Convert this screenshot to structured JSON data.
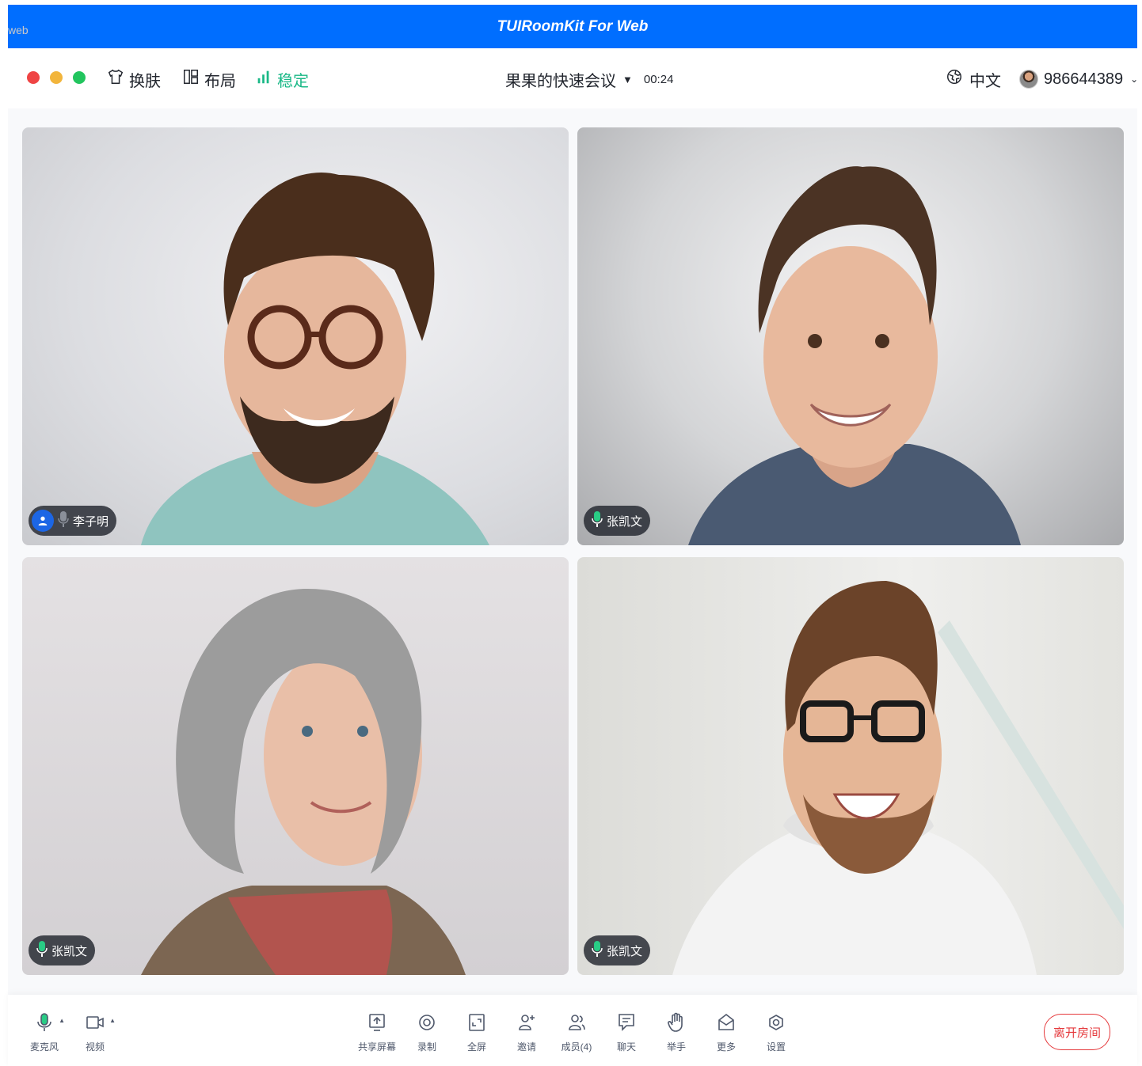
{
  "watermark": "web",
  "app": {
    "title": "TUIRoomKit For Web"
  },
  "header": {
    "window_dots": {
      "close": "#ef4444",
      "minimize": "#f2b53c",
      "maximize": "#22c55e"
    },
    "skin_label": "换肤",
    "layout_label": "布局",
    "network_label": "稳定",
    "room_name": "果果的快速会议",
    "timer": "00:24",
    "language": "中文",
    "user_id": "986644389"
  },
  "tiles": [
    {
      "name": "李子明",
      "is_self": true,
      "mic": "muted"
    },
    {
      "name": "张凯文",
      "is_self": false,
      "mic": "on"
    },
    {
      "name": "张凯文",
      "is_self": false,
      "mic": "on"
    },
    {
      "name": "张凯文",
      "is_self": false,
      "mic": "on"
    }
  ],
  "footer": {
    "mic_label": "麦克风",
    "camera_label": "视频",
    "share_label": "共享屏幕",
    "record_label": "录制",
    "fullscreen_label": "全屏",
    "invite_label": "邀请",
    "members_label": "成员(4)",
    "chat_label": "聊天",
    "raise_hand_label": "举手",
    "more_label": "更多",
    "settings_label": "设置",
    "leave_label": "离开房间"
  },
  "colors": {
    "title_bar": "#006eff",
    "network_ok": "#1ab887",
    "leave": "#e5393c",
    "mic_active": "#29cc85"
  }
}
